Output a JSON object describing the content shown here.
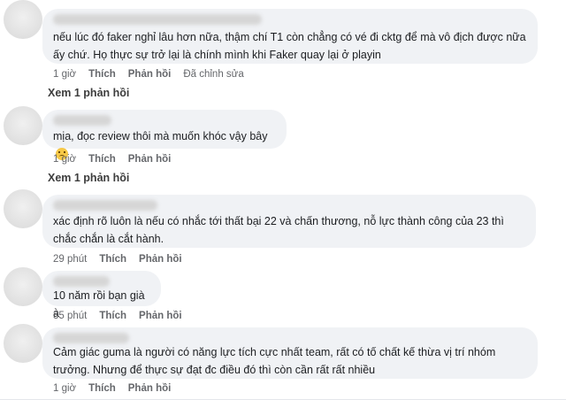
{
  "comments": [
    {
      "text": "nếu lúc đó faker nghỉ lâu hơn nữa, thậm chí T1 còn chẳng có vé đi cktg để mà vô địch được nữa ấy chứ. Họ thực sự trở lại là chính mình khi Faker quay lại ở playin",
      "time": "1 giờ",
      "like": "Thích",
      "reply": "Phản hồi",
      "edited": "Đã chỉnh sửa",
      "view_replies": "Xem 1 phản hồi"
    },
    {
      "text": "mịa, đọc review thôi mà muốn khóc vậy bây",
      "emoji": "sad-face-emoji",
      "time": "1 giờ",
      "like": "Thích",
      "reply": "Phản hồi",
      "view_replies": "Xem 1 phản hồi"
    },
    {
      "text": "xác định rõ luôn là nếu có nhắc tới thất bại 22 và chấn thương, nỗ lực thành công của 23 thì chắc chắn là cắt hành.",
      "time": "29 phút",
      "like": "Thích",
      "reply": "Phản hồi"
    },
    {
      "text": "10 năm rồi bạn già à",
      "time": "35 phút",
      "like": "Thích",
      "reply": "Phản hồi"
    },
    {
      "text": "Cảm giác guma là người có năng lực tích cực nhất team, rất có tố chất kế thừa vị trí nhóm trưởng. Nhưng để thực sự đạt đc điều đó thì còn cần rất rất nhiều",
      "time": "1 giờ",
      "like": "Thích",
      "reply": "Phản hồi"
    }
  ]
}
